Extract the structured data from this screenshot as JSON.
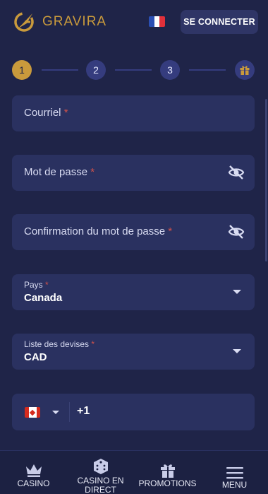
{
  "header": {
    "brand": "GRAVIRA",
    "login_label": "SE CONNECTER"
  },
  "stepper": {
    "steps": [
      "1",
      "2",
      "3"
    ],
    "current_step": 1,
    "final_step_icon": "gift-icon"
  },
  "form": {
    "email": {
      "label": "Courriel",
      "required_mark": "*"
    },
    "password": {
      "label": "Mot de passe",
      "required_mark": "*"
    },
    "password_confirm": {
      "label": "Confirmation du mot de passe",
      "required_mark": "*"
    },
    "country": {
      "label": "Pays",
      "required_mark": "*",
      "value": "Canada"
    },
    "currency": {
      "label": "Liste des devises",
      "required_mark": "*",
      "value": "CAD"
    },
    "phone": {
      "country_code": "+1",
      "flag": "canada-flag-icon"
    }
  },
  "bottom_nav": {
    "items": [
      {
        "label": "CASINO",
        "icon": "crown-icon"
      },
      {
        "label": "CASINO EN DIRECT",
        "icon": "dice-icon"
      },
      {
        "label": "PROMOTIONS",
        "icon": "gift-icon"
      },
      {
        "label": "MENU",
        "icon": "hamburger-icon"
      }
    ]
  },
  "colors": {
    "background": "#1f2448",
    "field": "#2a3160",
    "accent_gold": "#c99a3c",
    "step_inactive": "#353c7e",
    "required": "#d0524a"
  }
}
